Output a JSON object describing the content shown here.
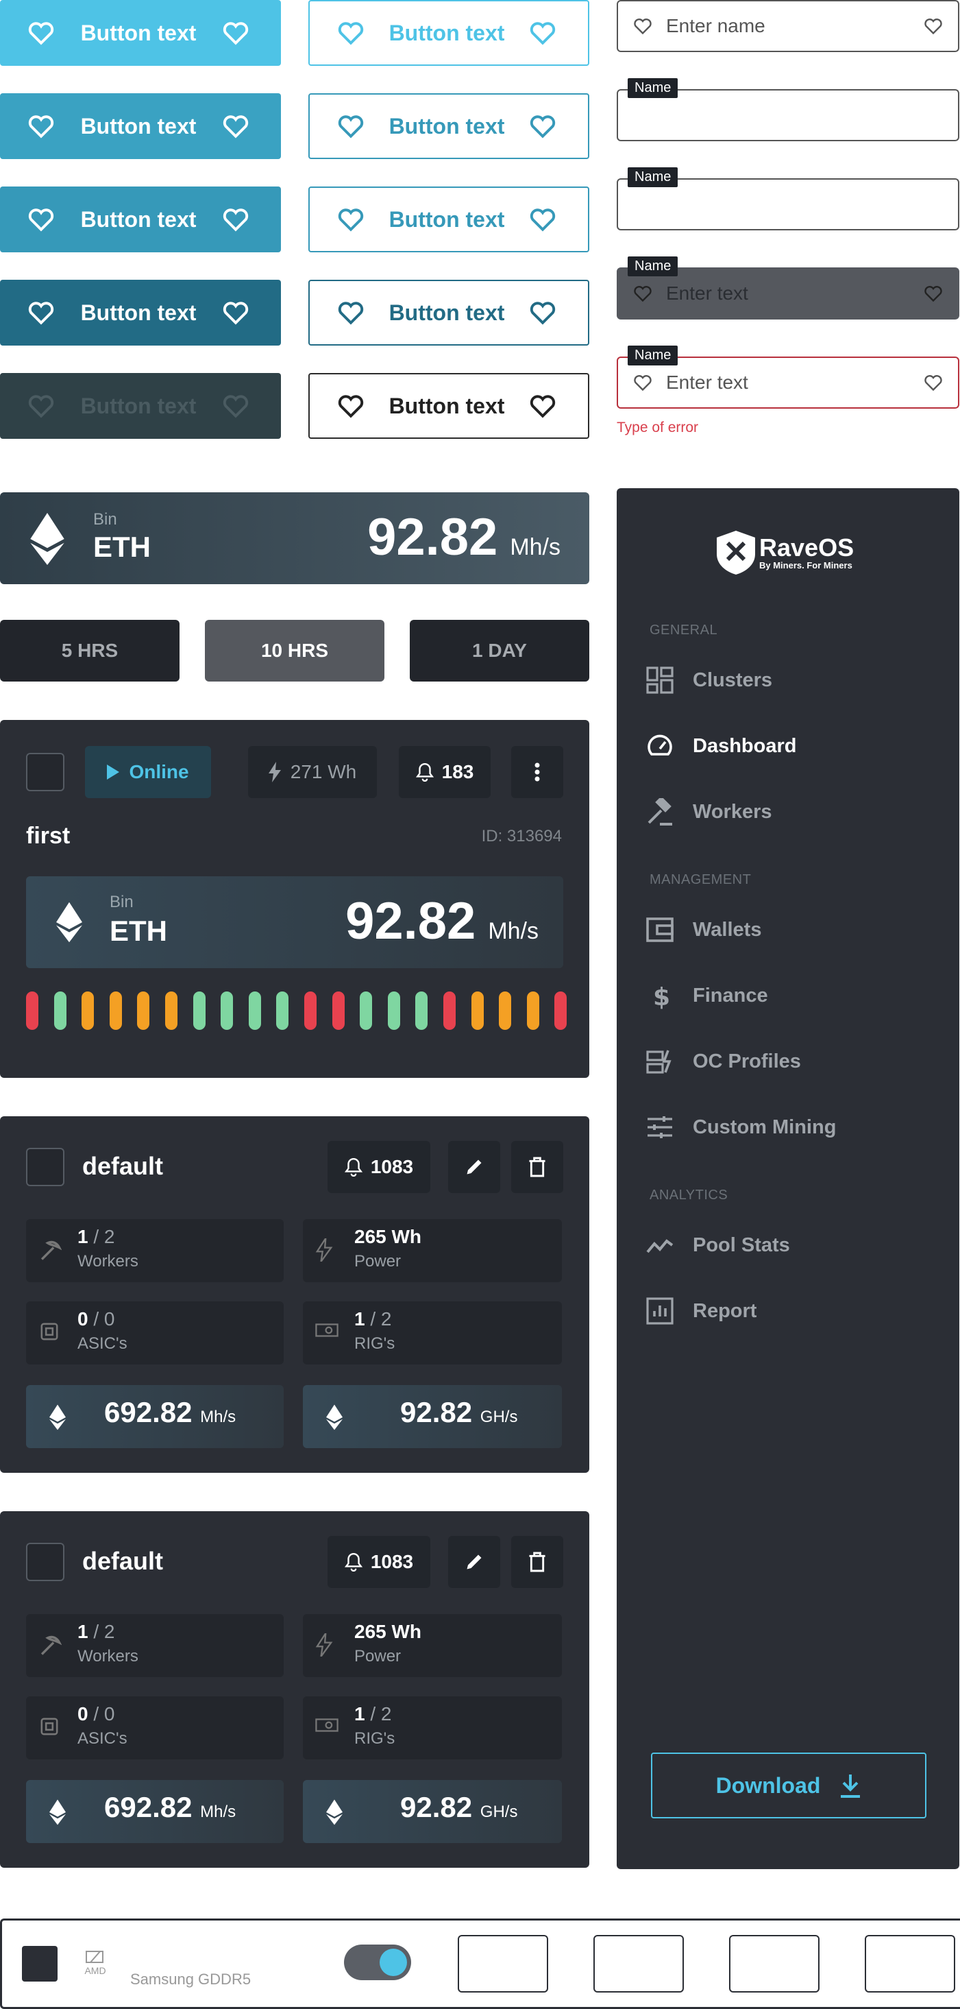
{
  "buttons": {
    "filled": [
      "Button text",
      "Button text",
      "Button text",
      "Button text",
      "Button text"
    ],
    "outlined": [
      "Button text",
      "Button text",
      "Button text",
      "Button text",
      "Button text"
    ]
  },
  "inputs": {
    "name_placeholder": "Enter name",
    "label": "Name",
    "text_placeholder": "Enter text",
    "error_text": "Type of error"
  },
  "eth_card": {
    "algo": "Bin",
    "coin": "ETH",
    "value": "92.82",
    "unit": "Mh/s"
  },
  "time_tabs": [
    "5 HRS",
    "10 HRS",
    "1 DAY"
  ],
  "worker": {
    "status": "Online",
    "power": "271 Wh",
    "alerts": "183",
    "name": "first",
    "id": "ID: 313694",
    "algo": "Bin",
    "coin": "ETH",
    "value": "92.82",
    "unit": "Mh/s",
    "bars": [
      "red",
      "green",
      "orange",
      "orange",
      "orange",
      "orange",
      "green",
      "green",
      "green",
      "green",
      "red",
      "red",
      "green",
      "green",
      "green",
      "red",
      "orange",
      "orange",
      "orange",
      "red"
    ]
  },
  "clusters": [
    {
      "name": "default",
      "alerts": "1083",
      "workers": "1",
      "workers_total": "/ 2",
      "workers_label": "Workers",
      "power": "265 Wh",
      "power_label": "Power",
      "asics": "0",
      "asics_total": "/ 0",
      "asics_label": "ASIC's",
      "rigs": "1",
      "rigs_total": "/ 2",
      "rigs_label": "RIG's",
      "hash1": "692.82",
      "hash1_unit": "Mh/s",
      "hash2": "92.82",
      "hash2_unit": "GH/s"
    },
    {
      "name": "default",
      "alerts": "1083",
      "workers": "1",
      "workers_total": "/ 2",
      "workers_label": "Workers",
      "power": "265 Wh",
      "power_label": "Power",
      "asics": "0",
      "asics_total": "/ 0",
      "asics_label": "ASIC's",
      "rigs": "1",
      "rigs_total": "/ 2",
      "rigs_label": "RIG's",
      "hash1": "692.82",
      "hash1_unit": "Mh/s",
      "hash2": "92.82",
      "hash2_unit": "GH/s"
    }
  ],
  "sidebar": {
    "logo": "RaveOS",
    "tagline": "By Miners. For Miners",
    "general": "GENERAL",
    "management": "MANAGEMENT",
    "analytics": "ANALYTICS",
    "items": [
      "Clusters",
      "Dashboard",
      "Workers",
      "Wallets",
      "Finance",
      "OC Profiles",
      "Custom Mining",
      "Pool Stats",
      "Report"
    ],
    "download": "Download"
  },
  "footer": {
    "amd": "AMD",
    "memory": "Samsung GDDR5"
  },
  "colors": {
    "accent": "#4ec3e6",
    "red": "#e8424f",
    "green": "#7fd6a1",
    "orange": "#f4a024",
    "panel": "#2b2e35"
  }
}
